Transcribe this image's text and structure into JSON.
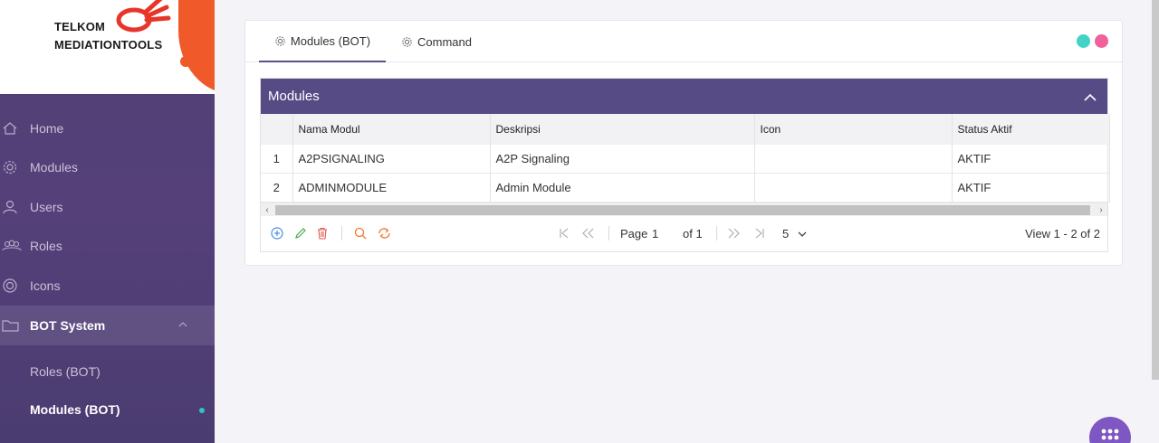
{
  "brand": {
    "line1": "TELKOM",
    "line2": "MEDIATIONTOOLS"
  },
  "sidebar": {
    "items": [
      {
        "label": "Home",
        "icon": "home-icon"
      },
      {
        "label": "Modules",
        "icon": "gear-icon"
      },
      {
        "label": "Users",
        "icon": "user-icon"
      },
      {
        "label": "Roles",
        "icon": "group-icon"
      },
      {
        "label": "Icons",
        "icon": "target-icon"
      },
      {
        "label": "BOT System",
        "icon": "folder-icon",
        "expanded": true
      }
    ],
    "subitems": [
      {
        "label": "Roles (BOT)"
      },
      {
        "label": "Modules (BOT)",
        "current": true
      }
    ]
  },
  "tabs": [
    {
      "label": "Modules (BOT)",
      "icon": "gear-icon",
      "active": true
    },
    {
      "label": "Command",
      "icon": "gear-icon"
    }
  ],
  "window_dots": {
    "colors": [
      "#42d3c4",
      "#f0609a"
    ]
  },
  "panel": {
    "title": "Modules",
    "columns": [
      "",
      "Nama Modul",
      "Deskripsi",
      "Icon",
      "Status Aktif"
    ],
    "rows": [
      {
        "no": "1",
        "nama": "A2PSIGNALING",
        "deskripsi": "A2P Signaling",
        "icon": "",
        "status": "AKTIF"
      },
      {
        "no": "2",
        "nama": "ADMINMODULE",
        "deskripsi": "Admin Module",
        "icon": "",
        "status": "AKTIF"
      }
    ]
  },
  "pager": {
    "page_label": "Page",
    "page_value": "1",
    "of_label": "of 1",
    "rows_per_page": "5",
    "view_text": "View 1 - 2 of 2"
  },
  "colors": {
    "sidebar_bg": "#4d3f72",
    "panel_header": "#574b86",
    "accent_dot": "#2dc6b9",
    "fab": "#7e57c2",
    "brand_orange": "#f05a2a"
  }
}
